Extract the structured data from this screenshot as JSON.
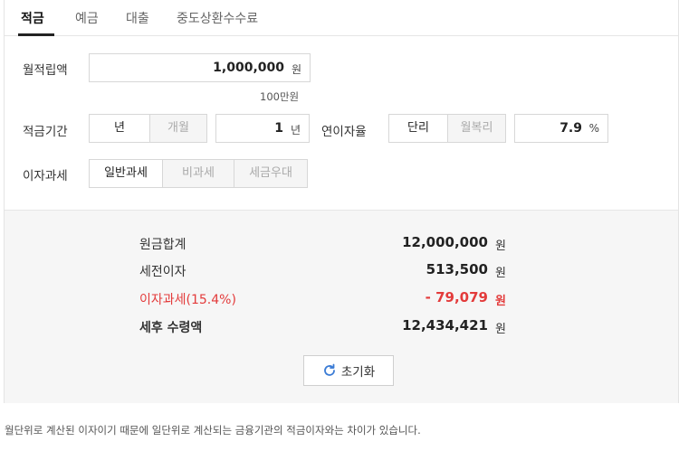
{
  "tabs": [
    "적금",
    "예금",
    "대출",
    "중도상환수수료"
  ],
  "form": {
    "monthly_label": "월적립액",
    "monthly_value": "1,000,000",
    "monthly_unit": "원",
    "monthly_hint": "100만원",
    "period_label": "적금기간",
    "period_opt_year": "년",
    "period_opt_month": "개월",
    "period_value": "1",
    "period_unit": "년",
    "rate_label": "연이자율",
    "rate_opt_simple": "단리",
    "rate_opt_compound": "월복리",
    "rate_value": "7.9",
    "rate_unit": "%",
    "tax_label": "이자과세",
    "tax_opt_general": "일반과세",
    "tax_opt_exempt": "비과세",
    "tax_opt_preferential": "세금우대"
  },
  "results": {
    "principal_label": "원금합계",
    "principal_value": "12,000,000",
    "pretax_label": "세전이자",
    "pretax_value": "513,500",
    "tax_label": "이자과세(15.4%)",
    "tax_value": "- 79,079",
    "net_label": "세후 수령액",
    "net_value": "12,434,421",
    "unit": "원"
  },
  "reset_label": "초기화",
  "note": "월단위로 계산된 이자이기 때문에 일단위로 계산되는 금융기관의 적금이자와는 차이가 있습니다.",
  "colors": {
    "accent_red": "#e33b3b",
    "refresh_blue": "#3a7bd5"
  }
}
